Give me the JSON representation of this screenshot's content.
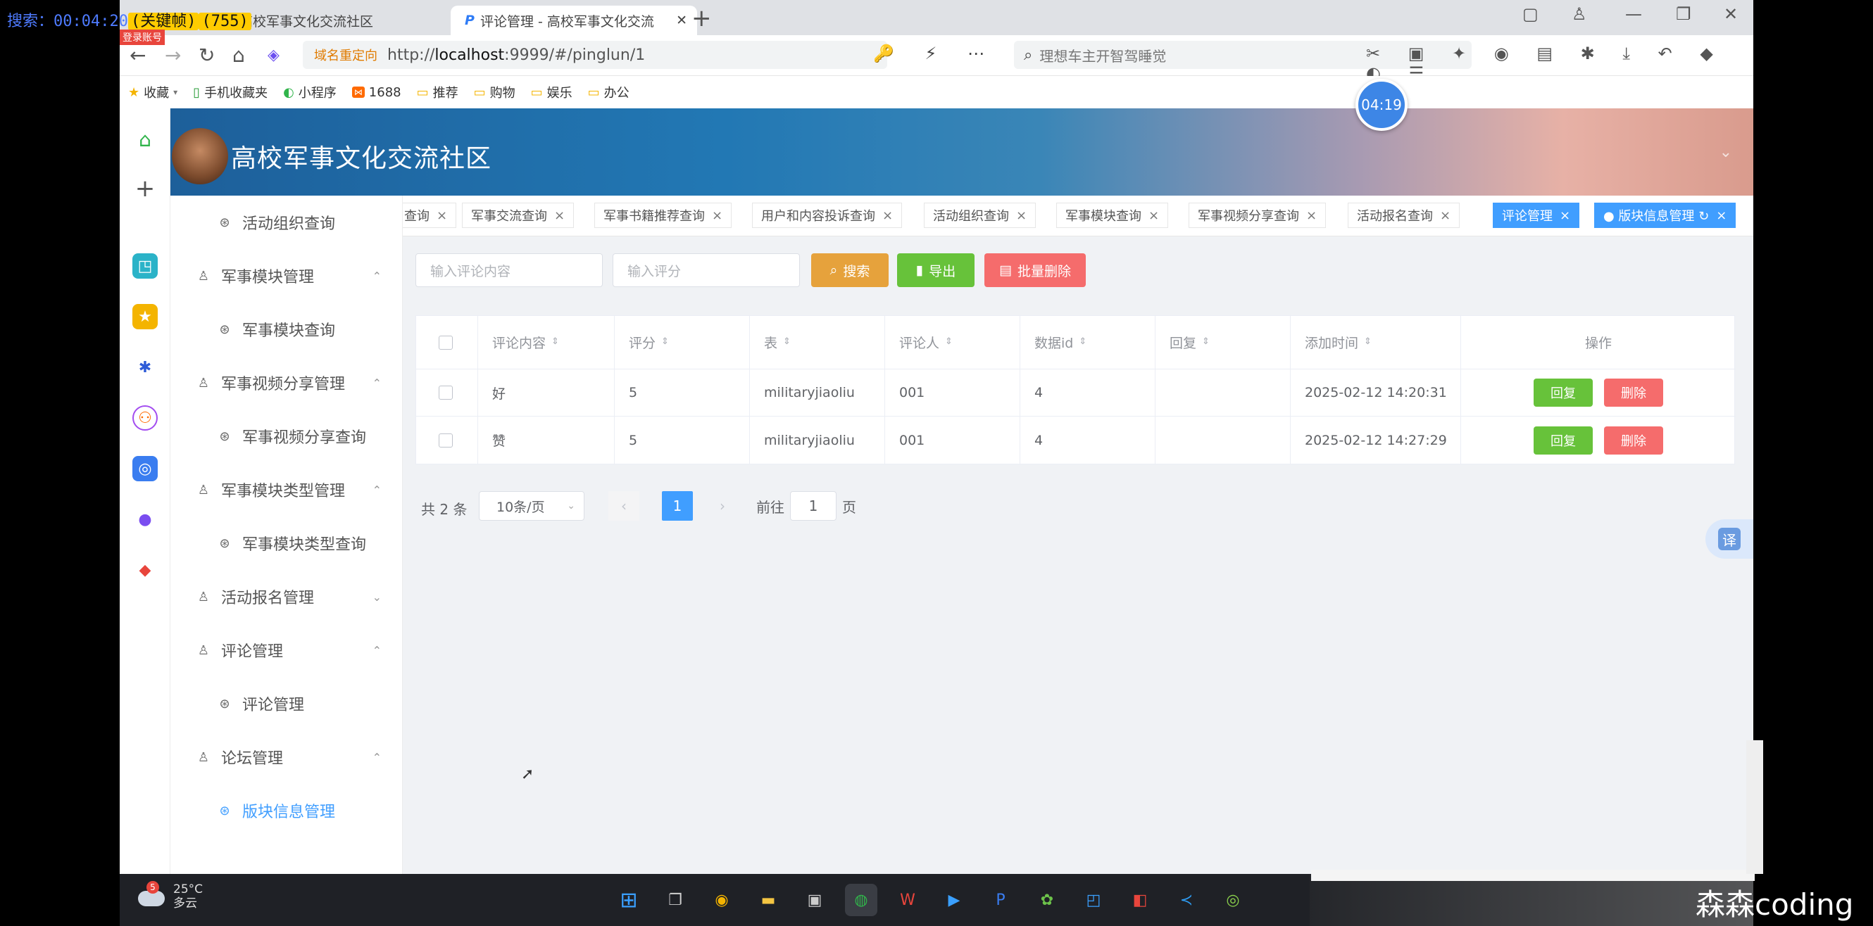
{
  "overlay": {
    "prefix": "搜索：00:04:20",
    "highlight": "(关键帧)",
    "count": "(755)",
    "badge": "登录账号"
  },
  "browser": {
    "tabs": [
      {
        "title": "高校军事文化交流社区"
      },
      {
        "title": "评论管理 - 高校军事文化交流"
      }
    ],
    "new_tab": "+",
    "url_tag": "域名重定向",
    "url_prefix": "http://",
    "url_host": "localhost",
    "url_rest": ":9999/#/pinglun/1",
    "url_icons": "🔑 ⚡ ⋯ ⌄",
    "search_placeholder": "理想车主开智驾睡觉",
    "ext_icons": "✂ ▣ ✦ ◉ ▤ ✱ ⤓ ↶ ◆ ◐ ☰",
    "bookmarks": [
      {
        "label": "收藏",
        "icon": "star"
      },
      {
        "label": "手机收藏夹",
        "icon": "phone"
      },
      {
        "label": "小程序",
        "icon": "circle"
      },
      {
        "label": "1688",
        "icon": "1688"
      },
      {
        "label": "推荐",
        "icon": "folder"
      },
      {
        "label": "购物",
        "icon": "folder"
      },
      {
        "label": "娱乐",
        "icon": "folder"
      },
      {
        "label": "办公",
        "icon": "folder"
      }
    ]
  },
  "timer": "04:19",
  "app": {
    "title": "高校军事文化交流社区",
    "sidebar": [
      {
        "label": "活动组织查询",
        "level": "child",
        "icon": "⊛"
      },
      {
        "label": "军事模块管理",
        "level": "parent",
        "icon": "♙",
        "chevron": "⌃"
      },
      {
        "label": "军事模块查询",
        "level": "child",
        "icon": "⊛"
      },
      {
        "label": "军事视频分享管理",
        "level": "parent",
        "icon": "♙",
        "chevron": "⌃"
      },
      {
        "label": "军事视频分享查询",
        "level": "child",
        "icon": "⊛"
      },
      {
        "label": "军事模块类型管理",
        "level": "parent",
        "icon": "♙",
        "chevron": "⌃"
      },
      {
        "label": "军事模块类型查询",
        "level": "child",
        "icon": "⊛"
      },
      {
        "label": "活动报名管理",
        "level": "parent",
        "icon": "♙",
        "chevron": "⌄"
      },
      {
        "label": "评论管理",
        "level": "parent",
        "icon": "♙",
        "chevron": "⌃"
      },
      {
        "label": "评论管理",
        "level": "child",
        "icon": "⊛"
      },
      {
        "label": "论坛管理",
        "level": "parent",
        "icon": "♙",
        "chevron": "⌃"
      },
      {
        "label": "版块信息管理",
        "level": "child",
        "icon": "⊛",
        "active": true
      }
    ],
    "tags": [
      {
        "label": "查询",
        "x": "×"
      },
      {
        "label": "军事交流查询",
        "x": "×"
      },
      {
        "label": "军事书籍推荐查询",
        "x": "×"
      },
      {
        "label": "用户和内容投诉查询",
        "x": "×"
      },
      {
        "label": "活动组织查询",
        "x": "×"
      },
      {
        "label": "军事模块查询",
        "x": "×"
      },
      {
        "label": "军事视频分享查询",
        "x": "×"
      },
      {
        "label": "活动报名查询",
        "x": "×"
      },
      {
        "label": "评论管理",
        "x": "×",
        "active": true
      },
      {
        "label": "● 版块信息管理 ↻",
        "x": "×",
        "active": true
      }
    ],
    "filters": {
      "content_placeholder": "输入评论内容",
      "score_placeholder": "输入评分",
      "search_btn": "搜索",
      "export_btn": "导出",
      "batch_delete_btn": "批量删除"
    },
    "table": {
      "headers": [
        "评论内容",
        "评分",
        "表",
        "评论人",
        "数据id",
        "回复",
        "添加时间",
        "操作"
      ],
      "rows": [
        {
          "content": "好",
          "score": "5",
          "table": "militaryjiaoliu",
          "user": "001",
          "data_id": "4",
          "reply": "",
          "time": "2025-02-12 14:20:31"
        },
        {
          "content": "赞",
          "score": "5",
          "table": "militaryjiaoliu",
          "user": "001",
          "data_id": "4",
          "reply": "",
          "time": "2025-02-12 14:27:29"
        }
      ],
      "reply_btn": "回复",
      "delete_btn": "删除"
    },
    "pagination": {
      "total": "共 2 条",
      "page_size": "10条/页",
      "prev": "‹",
      "current": "1",
      "next": "›",
      "goto_prefix": "前往",
      "goto_value": "1",
      "goto_suffix": "页"
    },
    "translate": "译"
  },
  "taskbar": {
    "badge": "5",
    "temp": "25°C",
    "weather": "多云"
  },
  "watermark": "森森coding",
  "colors": {
    "primary": "#409eff",
    "warning": "#e6a23c",
    "success": "#67c23a",
    "danger": "#f56c6c"
  }
}
